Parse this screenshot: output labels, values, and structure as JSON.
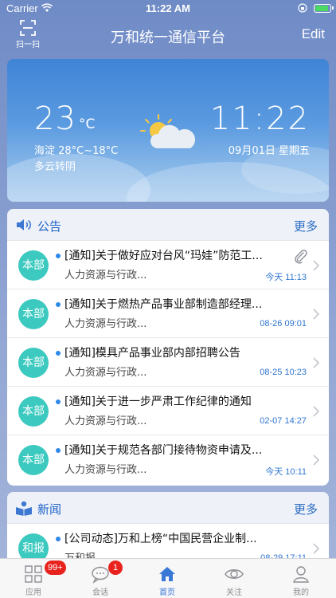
{
  "status_bar": {
    "carrier": "Carrier",
    "time": "11:22 AM"
  },
  "nav": {
    "scan_label": "扫一扫",
    "title": "万和统一通信平台",
    "edit_label": "Edit"
  },
  "weather": {
    "temperature": "23",
    "unit": "°C",
    "location_range": "海淀 28°C~18°C",
    "description": "多云转阴",
    "clock": "11:22",
    "date": "09月01日 星期五",
    "icon": "partly-cloudy-icon"
  },
  "announcements": {
    "title": "公告",
    "more": "更多",
    "items": [
      {
        "avatar": "本部",
        "title": "[通知]关于做好应对台风“玛娃”防范工...",
        "subtitle": "人力资源与行政...",
        "time": "今天 11:13",
        "attachment": true
      },
      {
        "avatar": "本部",
        "title": "[通知]关于燃热产品事业部制造部经理...",
        "subtitle": "人力资源与行政...",
        "time": "08-26 09:01"
      },
      {
        "avatar": "本部",
        "title": "[通知]模具产品事业部内部招聘公告",
        "subtitle": "人力资源与行政...",
        "time": "08-25 10:23"
      },
      {
        "avatar": "本部",
        "title": "[通知]关于进一步严肃工作纪律的通知",
        "subtitle": "人力资源与行政...",
        "time": "02-07 14:27"
      },
      {
        "avatar": "本部",
        "title": "[通知]关于规范各部门接待物资申请及...",
        "subtitle": "人力资源与行政...",
        "time": "今天 10:11"
      }
    ]
  },
  "news": {
    "title": "新闻",
    "more": "更多",
    "items": [
      {
        "avatar": "和报",
        "title": "[公司动态]万和上榜“中国民营企业制...",
        "subtitle": "万和报",
        "time": "08-29 17:11"
      }
    ]
  },
  "tab_bar": {
    "tabs": [
      {
        "label": "应用",
        "badge": "99+"
      },
      {
        "label": "会话",
        "badge": "1"
      },
      {
        "label": "首页"
      },
      {
        "label": "关注"
      },
      {
        "label": "我的"
      }
    ]
  },
  "colors": {
    "accent": "#3a78d8",
    "avatar": "#3cc9bf",
    "badge": "#e8231d"
  }
}
